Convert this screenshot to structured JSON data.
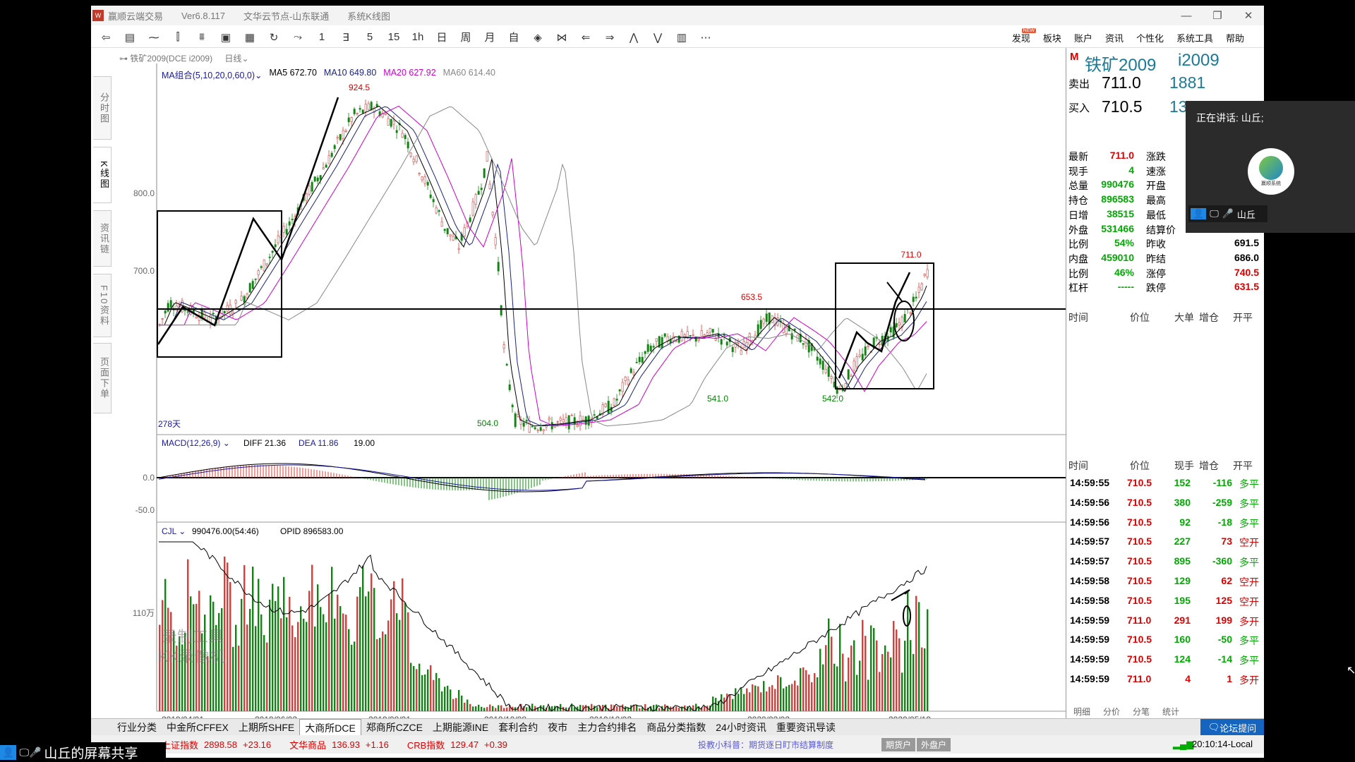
{
  "window": {
    "app_name": "赢顺云端交易",
    "version": "Ver6.8.117",
    "node": "文华云节点-山东联通",
    "mode": "系统K线图",
    "controls": [
      "—",
      "❐",
      "✕"
    ]
  },
  "toolbar": {
    "icons": [
      "back-icon",
      "list-icon",
      "line-chart-icon",
      "kline-icon",
      "tick-icon",
      "candle-box-icon",
      "save-icon",
      "refresh-icon",
      "draw-icon",
      "1",
      "3",
      "5",
      "15",
      "1h",
      "day",
      "week",
      "month",
      "custom",
      "expand-icon",
      "collapse-icon",
      "prev-icon",
      "next-icon",
      "up-icon",
      "down-icon",
      "layout-icon",
      "more-icon"
    ],
    "glyphs": [
      "⇦",
      "▤",
      "⁓",
      "⫿",
      "⩩",
      "▣",
      "▦",
      "↻",
      "⤳",
      "1",
      "∃",
      "5",
      "15",
      "1h",
      "日",
      "周",
      "月",
      "自",
      "◈",
      "⋈",
      "⇐",
      "⇒",
      "⋀",
      "⋁",
      "▥",
      "⋯"
    ],
    "badge_new": "NEW",
    "menu": [
      "发现",
      "板块",
      "账户",
      "资讯",
      "个性化",
      "系统工具",
      "帮助"
    ]
  },
  "side_tabs": [
    "分时图",
    "K线图",
    "资讯链",
    "F10资料",
    "页面下单"
  ],
  "chart": {
    "symbol_line": "铁矿2009(DCE i2009)",
    "period": "日线",
    "ma_label": "MA组合(5,10,20,0,60,0)",
    "ma5": "MA5 672.70",
    "ma10": "MA10 649.80",
    "ma20": "MA20 627.92",
    "ma60": "MA60 614.40",
    "colors": {
      "ma5": "#000000",
      "ma10": "#1a237e",
      "ma20": "#cc00cc",
      "ma60": "#888888",
      "up": "#e53935",
      "down": "#0a8a0a"
    },
    "price_ticks": [
      "800.0",
      "700.0"
    ],
    "annotations": [
      "924.5",
      "653.5",
      "711.0",
      "504.0",
      "541.0",
      "542.0"
    ],
    "days_label": "278天",
    "macd_label": "MACD(12,26,9)",
    "diff": "DIFF 21.36",
    "dea": "DEA 11.86",
    "macd_val": "19.00",
    "macd_ticks": [
      "0.0",
      "-50.0"
    ],
    "vol_label": "CJL",
    "vol_value": "990476.00(54:46)",
    "opid": "OPID 896583.00",
    "vol_tick": "110万",
    "dates": [
      "2019/04/01",
      "2019/06/03",
      "2019/08/01",
      "2019/10/08",
      "2019/12/02",
      "2020/03/02",
      "2020/05/19"
    ],
    "watermark": [
      "录制工具",
      "KK录像机"
    ]
  },
  "quote": {
    "badge": "M",
    "name": "铁矿2009",
    "code": "i2009",
    "ask_label": "卖出",
    "ask_price": "711.0",
    "ask_vol": "1881",
    "bid_label": "买入",
    "bid_price": "710.5",
    "bid_vol": "13",
    "rows": [
      {
        "l1": "最新",
        "v1": "711.0",
        "c1": "#d00",
        "l2": "涨跌",
        "v2": "",
        "c2": "#000"
      },
      {
        "l1": "现手",
        "v1": "4",
        "c1": "#0a0",
        "l2": "速涨",
        "v2": "",
        "c2": "#000"
      },
      {
        "l1": "总量",
        "v1": "990476",
        "c1": "#0a0",
        "l2": "开盘",
        "v2": "",
        "c2": "#000"
      },
      {
        "l1": "持仓",
        "v1": "896583",
        "c1": "#0a0",
        "l2": "最高",
        "v2": "",
        "c2": "#000"
      },
      {
        "l1": "日增",
        "v1": "38515",
        "c1": "#0a0",
        "l2": "最低",
        "v2": "",
        "c2": "#000"
      },
      {
        "l1": "外盘",
        "v1": "531466",
        "c1": "#0a0",
        "l2": "结算价",
        "v2": "",
        "c2": "#000"
      },
      {
        "l1": "比例",
        "v1": "54%",
        "c1": "#0a0",
        "l2": "昨收",
        "v2": "691.5",
        "c2": "#000"
      },
      {
        "l1": "内盘",
        "v1": "459010",
        "c1": "#0a0",
        "l2": "昨结",
        "v2": "686.0",
        "c2": "#000"
      },
      {
        "l1": "比例",
        "v1": "46%",
        "c1": "#0a0",
        "l2": "涨停",
        "v2": "740.5",
        "c2": "#d00"
      },
      {
        "l1": "杠杆",
        "v1": "-----",
        "c1": "#0a0",
        "l2": "跌停",
        "v2": "631.5",
        "c2": "#d00"
      }
    ],
    "col_headers_top": [
      "时间",
      "价位",
      "大单",
      "增仓",
      "开平"
    ],
    "col_headers_ticks": [
      "时间",
      "价位",
      "现手",
      "增仓",
      "开平"
    ],
    "ticks": [
      [
        "14:59:55",
        "710.5",
        "152",
        "-116",
        "多平"
      ],
      [
        "14:59:56",
        "710.5",
        "380",
        "-259",
        "多平"
      ],
      [
        "14:59:56",
        "710.5",
        "92",
        "-18",
        "多平"
      ],
      [
        "14:59:57",
        "710.5",
        "227",
        "73",
        "空开"
      ],
      [
        "14:59:57",
        "710.5",
        "895",
        "-360",
        "多平"
      ],
      [
        "14:59:58",
        "710.5",
        "129",
        "62",
        "空开"
      ],
      [
        "14:59:58",
        "710.5",
        "195",
        "125",
        "空开"
      ],
      [
        "14:59:59",
        "711.0",
        "291",
        "199",
        "多开"
      ],
      [
        "14:59:59",
        "710.5",
        "160",
        "-50",
        "多平"
      ],
      [
        "14:59:59",
        "710.5",
        "124",
        "-14",
        "多平"
      ],
      [
        "14:59:59",
        "711.0",
        "4",
        "1",
        "多开"
      ]
    ],
    "bottom_tabs": [
      "明细",
      "分价",
      "分笔",
      "统计"
    ]
  },
  "exchange_tabs": [
    "行业分类",
    "中金所CFFEX",
    "上期所SHFE",
    "大商所DCE",
    "郑商所CZCE",
    "上期能源INE",
    "套利合约",
    "夜市",
    "主力合约排名",
    "商品分类指数",
    "24小时资讯",
    "重要资讯导读"
  ],
  "forum": "论坛提问",
  "status": {
    "idx1_name": "上证指数",
    "idx1_val": "2898.58",
    "idx1_chg": "+23.16",
    "idx2_name": "文华商品",
    "idx2_val": "136.93",
    "idx2_chg": "+1.16",
    "idx3_name": "CRB指数",
    "idx3_val": "129.47",
    "idx3_chg": "+0.39",
    "notice": "投教小科普：期货逐日盯市结算制度",
    "btn1": "期货户",
    "btn2": "外盘户",
    "time": "20:10:14-Local"
  },
  "overlay": {
    "speaking": "正在讲话: 山丘;",
    "user": "山丘",
    "logo_text": "赢顺系统",
    "share": "山丘的屏幕共享"
  }
}
